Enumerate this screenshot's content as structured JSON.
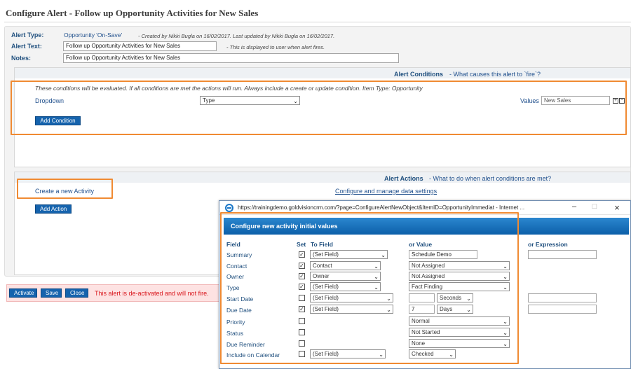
{
  "page": {
    "title": "Configure Alert - Follow up Opportunity Activities for New Sales"
  },
  "alert": {
    "type_label": "Alert Type:",
    "type_value": "Opportunity 'On-Save'",
    "type_meta": "- Created by Nikki Bugla on 16/02/2017. Last updated by Nikki Bugla on 16/02/2017.",
    "text_label": "Alert Text:",
    "text_value": "Follow up Opportunity Activities for New Sales",
    "text_note": "- This is displayed to user when alert fires.",
    "notes_label": "Notes:",
    "notes_value": "Follow up Opportunity Activities for New Sales"
  },
  "conditions": {
    "title": "Alert Conditions",
    "subtitle": "- What causes this alert to `fire`?",
    "info": "These conditions will be evaluated.  If all conditions are met the actions will run. Always include a create or update condition. Item Type: Opportunity",
    "row_label": "Dropdown",
    "field_select": "Type",
    "values_label": "Values",
    "values_value": "New Sales",
    "add_button": "Add Condition"
  },
  "actions": {
    "title": "Alert Actions",
    "subtitle": "- What to do when alert conditions are met?",
    "item_link": "Create a new Activity",
    "manage_link": "Configure and manage data settings",
    "add_button": "Add Action"
  },
  "action_bar": {
    "activate": "Activate",
    "save": "Save",
    "close": "Close",
    "warning": "This alert is de-activated and will not fire."
  },
  "popup": {
    "url": "https://trainingdemo.goldvisioncrm.com/?page=ConfigureAlertNewObject&ItemID=OpportunityImmediat - Internet ...",
    "header": "Configure new activity initial values",
    "columns": {
      "field": "Field",
      "set": "Set",
      "to_field": "To Field",
      "or_value": "or Value",
      "or_expression": "or Expression"
    },
    "rows": [
      {
        "field": "Summary",
        "set": true,
        "to_field": "(Set Field)",
        "value": "Schedule Demo"
      },
      {
        "field": "Contact",
        "set": true,
        "to_field": "Contact",
        "value": "Not Assigned"
      },
      {
        "field": "Owner",
        "set": true,
        "to_field": "Owner",
        "value": "Not Assigned"
      },
      {
        "field": "Type",
        "set": true,
        "to_field": "(Set Field)",
        "value": "Fact Finding"
      },
      {
        "field": "Start Date",
        "set": false,
        "to_field": "(Set Field)",
        "value": "",
        "unit": "Seconds"
      },
      {
        "field": "Due Date",
        "set": true,
        "to_field": "(Set Field)",
        "value": "7",
        "unit": "Days"
      },
      {
        "field": "Priority",
        "set": false,
        "to_field": "",
        "value": "Normal"
      },
      {
        "field": "Status",
        "set": false,
        "to_field": "",
        "value": "Not Started"
      },
      {
        "field": "Due Reminder",
        "set": false,
        "to_field": "",
        "value": "None"
      },
      {
        "field": "Include on Calendar",
        "set": false,
        "to_field": "(Set Field)",
        "value": "Checked"
      }
    ]
  },
  "colors": {
    "highlight": "#f08a32",
    "primary_button": "#1563ad",
    "warning_text": "#d9161c",
    "label_blue": "#1f4f7e"
  }
}
